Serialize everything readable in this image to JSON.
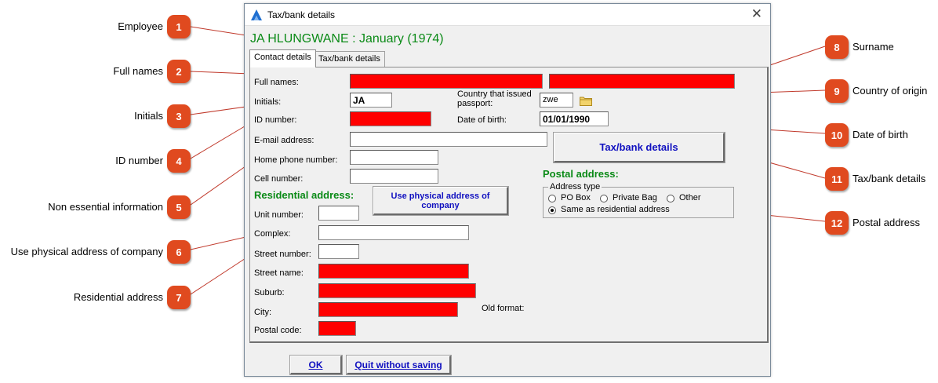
{
  "window": {
    "title": "Tax/bank details",
    "close_glyph": "✕",
    "app_icon": "blue-triangle-app-icon",
    "employee_heading": "JA HLUNGWANE : January (1974)"
  },
  "tabs": [
    {
      "label": "Contact details",
      "active": true
    },
    {
      "label": "Tax/bank details",
      "active": false
    }
  ],
  "form": {
    "full_names_label": "Full names:",
    "initials_label": "Initials:",
    "initials_value": "JA",
    "id_number_label": "ID number:",
    "email_label": "E-mail address:",
    "home_phone_label": "Home phone number:",
    "cell_label": "Cell number:",
    "passport_country_label_line1": "Country that issued",
    "passport_country_label_line2": "passport:",
    "passport_country_value": "zwe",
    "dob_label": "Date of birth:",
    "dob_value": "01/01/1990",
    "tax_bank_button": "Tax/bank details",
    "postal_heading": "Postal address:",
    "address_type_legend": "Address type",
    "address_types": [
      "PO Box",
      "Private Bag",
      "Other",
      "Same as residential address"
    ],
    "address_type_selected": "Same as residential address",
    "residential_heading": "Residential address:",
    "use_physical_button_line1": "Use physical address of",
    "use_physical_button_line2": "company",
    "unit_number_label": "Unit number:",
    "complex_label": "Complex:",
    "street_number_label": "Street number:",
    "street_name_label": "Street name:",
    "suburb_label": "Suburb:",
    "city_label": "City:",
    "old_format_label": "Old format:",
    "postal_code_label": "Postal code:"
  },
  "buttons": {
    "ok": "OK",
    "quit": "Quit without saving"
  },
  "callouts": [
    {
      "number": "1",
      "label": "Employee"
    },
    {
      "number": "2",
      "label": "Full names"
    },
    {
      "number": "3",
      "label": "Initials"
    },
    {
      "number": "4",
      "label": "ID number"
    },
    {
      "number": "5",
      "label": "Non essential information"
    },
    {
      "number": "6",
      "label": "Use physical address of company"
    },
    {
      "number": "7",
      "label": "Residential address"
    },
    {
      "number": "8",
      "label": "Surname"
    },
    {
      "number": "9",
      "label": "Country of origin"
    },
    {
      "number": "10",
      "label": "Date of birth"
    },
    {
      "number": "11",
      "label": "Tax/bank details"
    },
    {
      "number": "12",
      "label": "Postal address"
    }
  ],
  "colors": {
    "required_field": "#ff0000",
    "heading_green": "#0a8a16",
    "button_text_blue": "#1010c0",
    "callout_badge": "#e04a1f",
    "leader_line": "#c0392b"
  }
}
